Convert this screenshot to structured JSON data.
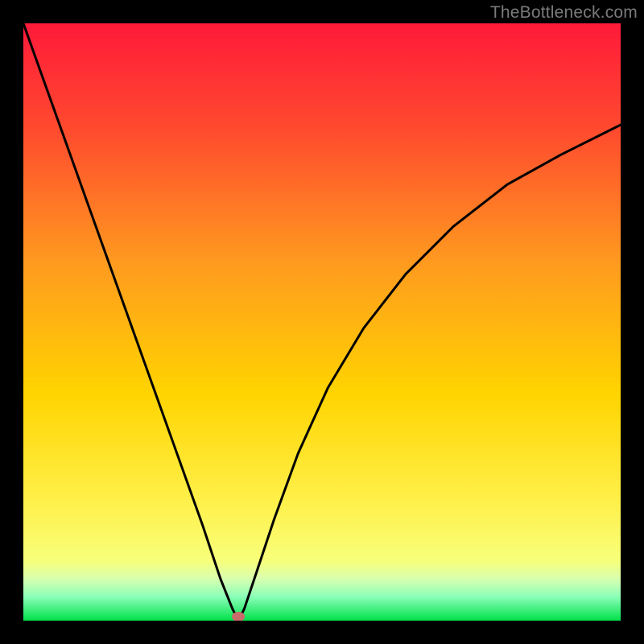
{
  "watermark": "TheBottleneck.com",
  "chart_data": {
    "type": "line",
    "title": "",
    "xlabel": "",
    "ylabel": "",
    "xlim": [
      0,
      100
    ],
    "ylim": [
      0,
      100
    ],
    "minimum_marker": {
      "x": 36,
      "y": 0
    },
    "series": [
      {
        "name": "curve",
        "x": [
          0,
          5,
          10,
          15,
          20,
          25,
          30,
          33,
          35,
          36,
          37,
          39,
          42,
          46,
          51,
          57,
          64,
          72,
          81,
          90,
          100
        ],
        "values": [
          100,
          86,
          72,
          58,
          44,
          30,
          16,
          7,
          2,
          0,
          2,
          8,
          17,
          28,
          39,
          49,
          58,
          66,
          73,
          78,
          83
        ]
      }
    ],
    "background_gradient": {
      "top_color": "#ff1a3a",
      "mid_color": "#ffd400",
      "green_start": 0.93,
      "bottom_color": "#00e04a"
    }
  }
}
